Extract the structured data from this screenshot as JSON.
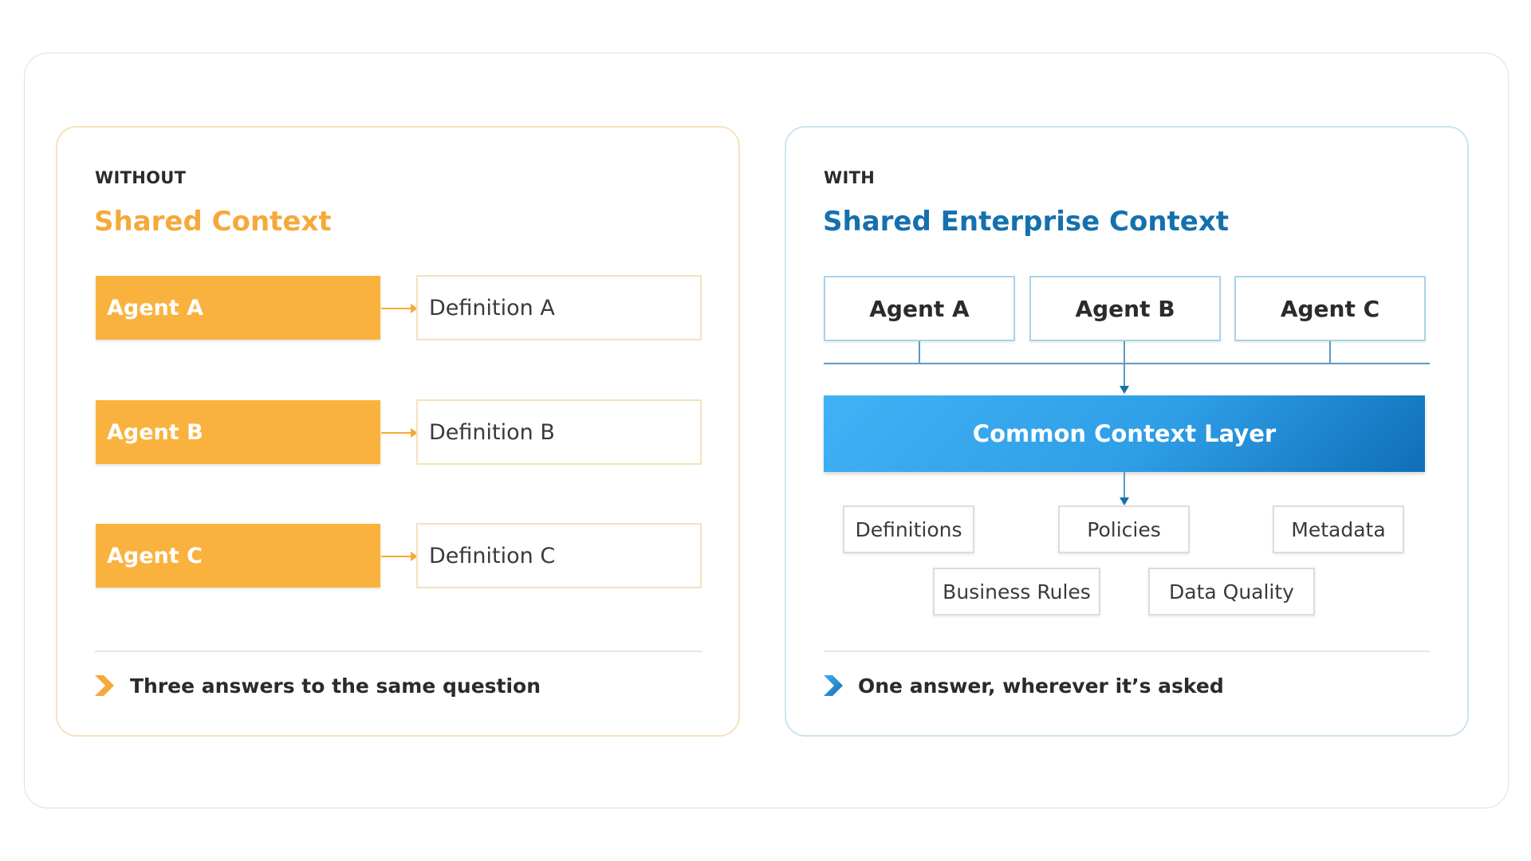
{
  "without": {
    "eyebrow": "WITHOUT",
    "title": "Shared Context",
    "rows": [
      {
        "agent": "Agent A",
        "definition": "Definition A"
      },
      {
        "agent": "Agent B",
        "definition": "Definition B"
      },
      {
        "agent": "Agent C",
        "definition": "Definition C"
      }
    ],
    "footer": "Three answers to the same question",
    "chevron_icon": "chevron-right-icon",
    "accent_color": "#f5a93a"
  },
  "with": {
    "eyebrow": "WITH",
    "title": "Shared Enterprise Context",
    "agents": [
      "Agent A",
      "Agent B",
      "Agent C"
    ],
    "layer": "Common Context Layer",
    "items_row1": [
      "Definitions",
      "Policies",
      "Metadata"
    ],
    "items_row2": [
      "Business Rules",
      "Data Quality"
    ],
    "footer": "One answer, wherever it’s asked",
    "chevron_icon": "chevron-right-icon",
    "accent_color": "#1570ad"
  }
}
